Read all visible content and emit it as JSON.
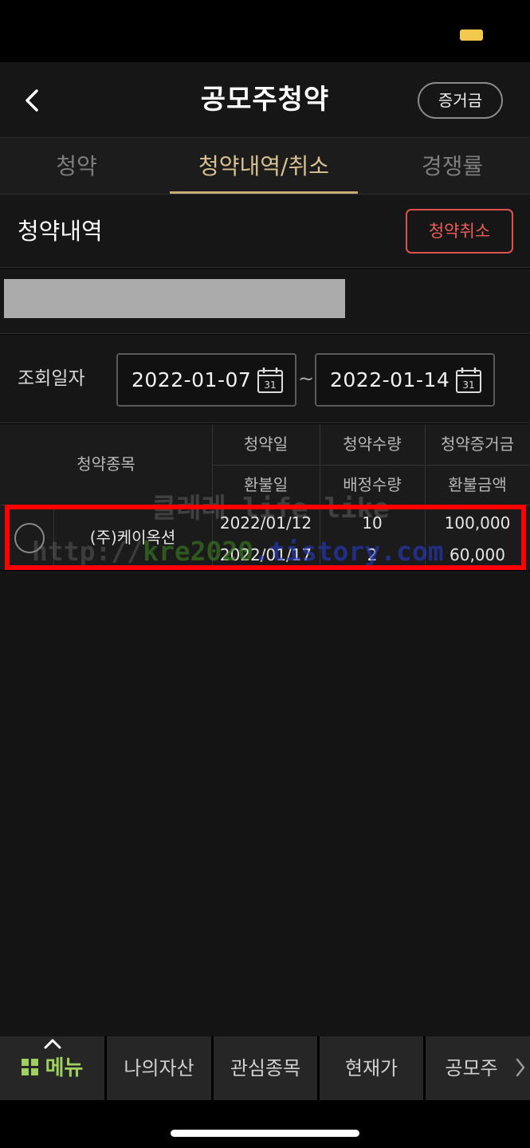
{
  "header": {
    "title": "공모주청약",
    "deposit_button": "증거금"
  },
  "tabs": [
    {
      "label": "청약",
      "active": false
    },
    {
      "label": "청약내역/취소",
      "active": true
    },
    {
      "label": "경쟁률",
      "active": false
    }
  ],
  "section": {
    "title": "청약내역",
    "cancel_button": "청약취소"
  },
  "query": {
    "label": "조회일자",
    "start_date": "2022-01-07",
    "end_date": "2022-01-14",
    "separator": "~",
    "calendar_day": "31"
  },
  "table": {
    "headers": {
      "item": "청약종목",
      "subscription_date": "청약일",
      "subscription_qty": "청약수량",
      "deposit": "청약증거금",
      "refund_date": "환불일",
      "allocated_qty": "배정수량",
      "refund_amount": "환불금액"
    },
    "rows": [
      {
        "name": "(주)케이옥션",
        "subscription_date": "2022/01/12",
        "subscription_qty": "10",
        "deposit": "100,000",
        "refund_date": "2022/01/17",
        "allocated_qty": "2",
        "refund_amount": "60,000"
      }
    ]
  },
  "watermark": {
    "line1": "클레레 life like",
    "line2_a": "http://",
    "line2_b": "kre2020",
    "line2_c": ".tistory.com"
  },
  "bottom_nav": [
    {
      "label": "메뉴"
    },
    {
      "label": "나의자산"
    },
    {
      "label": "관심종목"
    },
    {
      "label": "현재가"
    },
    {
      "label": "공모주"
    }
  ],
  "colors": {
    "accent_gold": "#c7ab76",
    "cancel_red": "#e0524f",
    "menu_green": "#9fcf5e",
    "highlight_red": "#ff0000"
  }
}
